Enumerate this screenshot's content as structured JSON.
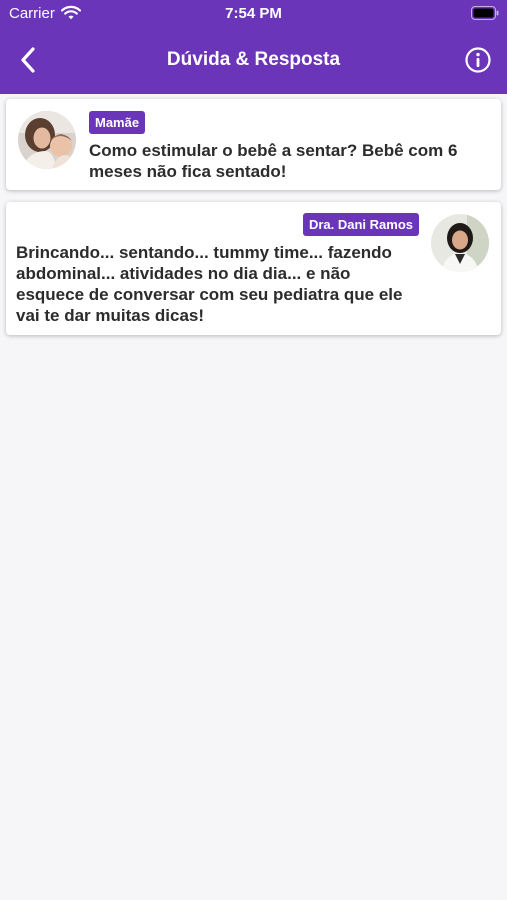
{
  "status_bar": {
    "carrier": "Carrier",
    "time": "7:54 PM"
  },
  "nav": {
    "title": "Dúvida & Resposta",
    "back_icon": "chevron-left-icon",
    "info_icon": "info-circle-icon"
  },
  "colors": {
    "primary": "#6a35b8",
    "background": "#f6f6f8",
    "card": "#ffffff",
    "text": "#2c2c2c"
  },
  "question": {
    "author_badge": "Mamãe",
    "text": "Como estimular o bebê a sentar? Bebê com 6 meses não fica sentado!"
  },
  "answer": {
    "author_badge": "Dra. Dani Ramos",
    "text": "Brincando... sentando... tummy time... fazendo abdominal... atividades no dia dia... e não esquece de conversar com seu pediatra que ele vai te dar muitas dicas!"
  }
}
